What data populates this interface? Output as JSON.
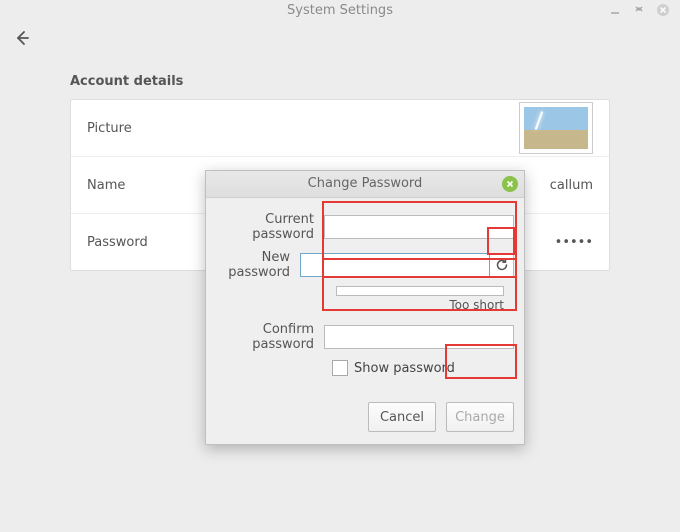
{
  "window": {
    "title": "System Settings"
  },
  "section": {
    "title": "Account details",
    "rows": {
      "picture_label": "Picture",
      "name_label": "Name",
      "name_value": "callum",
      "password_label": "Password",
      "password_value": "•••••"
    }
  },
  "dialog": {
    "title": "Change Password",
    "current_label": "Current password",
    "new_label": "New password",
    "confirm_label": "Confirm password",
    "strength_text": "Too short",
    "show_password_label": "Show password",
    "cancel_label": "Cancel",
    "change_label": "Change",
    "current_value": "",
    "new_value": "",
    "confirm_value": ""
  }
}
